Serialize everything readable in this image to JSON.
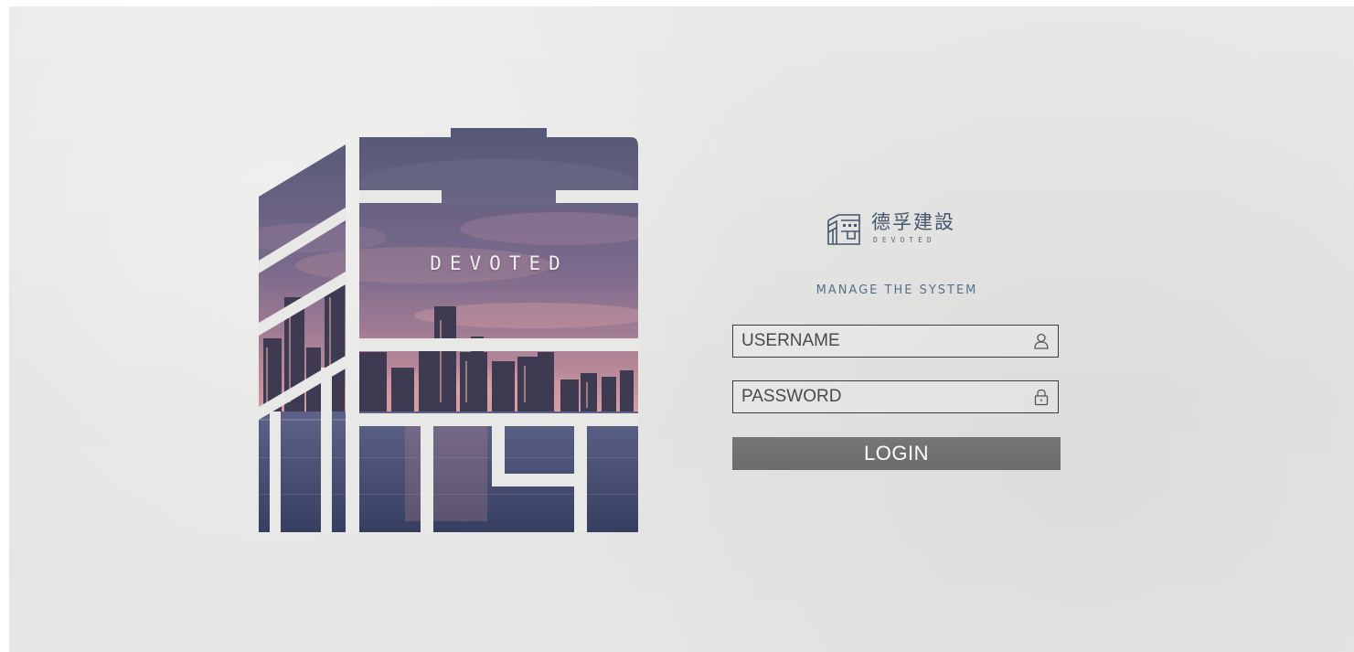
{
  "artwork": {
    "overlay_text": "DEVOTED",
    "sky_colors": [
      "#585a7b",
      "#8a6f8e",
      "#c88f9d"
    ],
    "water_colors": [
      "#3c4566",
      "#5a5f84"
    ]
  },
  "brand": {
    "chinese_name": "德孚建設",
    "english_name": "DEVOTED",
    "logo_icon": "building-logo-icon"
  },
  "login": {
    "subtitle": "MANAGE THE SYSTEM",
    "username": {
      "placeholder": "USERNAME",
      "value": "",
      "icon": "user-icon"
    },
    "password": {
      "placeholder": "PASSWORD",
      "value": "",
      "icon": "lock-icon"
    },
    "button_label": "LOGIN"
  },
  "colors": {
    "background": "#e6e6e5",
    "brand_text": "#44566c",
    "subtitle_text": "#56708a",
    "button_bg": "#727272",
    "button_text": "#ffffff",
    "field_border": "#3d3d3d"
  }
}
